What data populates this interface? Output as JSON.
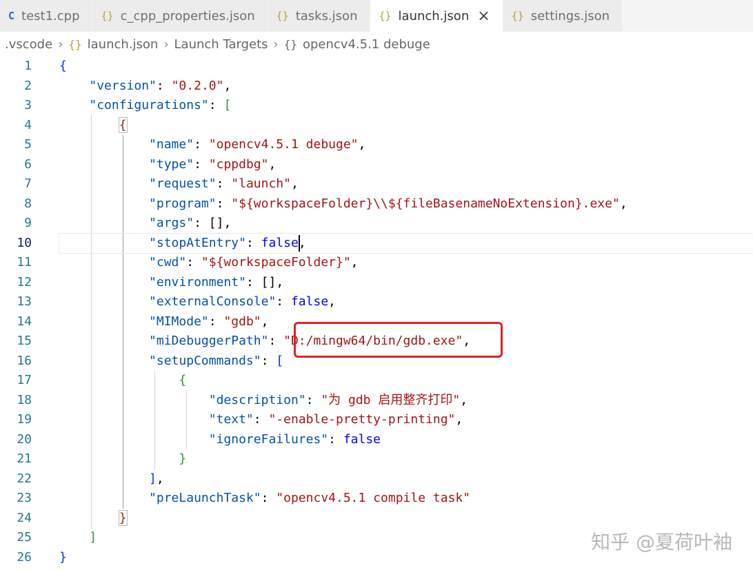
{
  "tabs": [
    {
      "label": "test1.cpp",
      "icon": "cpp-icon",
      "active": false
    },
    {
      "label": "c_cpp_properties.json",
      "icon": "json-icon",
      "active": false
    },
    {
      "label": "tasks.json",
      "icon": "json-icon",
      "active": false
    },
    {
      "label": "launch.json",
      "icon": "json-icon",
      "active": true
    },
    {
      "label": "settings.json",
      "icon": "json-icon",
      "active": false
    }
  ],
  "breadcrumb": {
    "folder": ".vscode",
    "file": "launch.json",
    "section": "Launch Targets",
    "item": "opencv4.5.1 debuge"
  },
  "editor": {
    "current_line": 10,
    "line_numbers": [
      "1",
      "2",
      "3",
      "4",
      "5",
      "6",
      "7",
      "8",
      "9",
      "10",
      "11",
      "12",
      "13",
      "14",
      "15",
      "16",
      "17",
      "18",
      "19",
      "20",
      "21",
      "22",
      "23",
      "24",
      "25",
      "26"
    ],
    "highlighted_line": 15,
    "keys": {
      "version": "\"version\"",
      "configurations": "\"configurations\"",
      "name": "\"name\"",
      "type": "\"type\"",
      "request": "\"request\"",
      "program": "\"program\"",
      "args": "\"args\"",
      "stopAtEntry": "\"stopAtEntry\"",
      "cwd": "\"cwd\"",
      "environment": "\"environment\"",
      "externalConsole": "\"externalConsole\"",
      "MIMode": "\"MIMode\"",
      "miDebuggerPath": "\"miDebuggerPath\"",
      "setupCommands": "\"setupCommands\"",
      "description": "\"description\"",
      "text": "\"text\"",
      "ignoreFailures": "\"ignoreFailures\"",
      "preLaunchTask": "\"preLaunchTask\""
    },
    "values": {
      "version": "\"0.2.0\"",
      "name": "\"opencv4.5.1 debuge\"",
      "type": "\"cppdbg\"",
      "request": "\"launch\"",
      "program": "\"${workspaceFolder}\\\\${fileBasenameNoExtension}.exe\"",
      "args": "[]",
      "stopAtEntry": "false",
      "cwd": "\"${workspaceFolder}\"",
      "environment": "[]",
      "externalConsole": "false",
      "MIMode": "\"gdb\"",
      "miDebuggerPath": "\"D:/mingw64/bin/gdb.exe\"",
      "description": "\"为 gdb 启用整齐打印\"",
      "text": "\"-enable-pretty-printing\"",
      "ignoreFailures": "false",
      "preLaunchTask": "\"opencv4.5.1 compile task\""
    }
  },
  "watermark": "知乎 @夏荷叶袖",
  "colors": {
    "key": "#0451a5",
    "string": "#a31515",
    "boolean": "#0000ff",
    "highlight_box": "#e02020",
    "line_number": "#237893"
  }
}
